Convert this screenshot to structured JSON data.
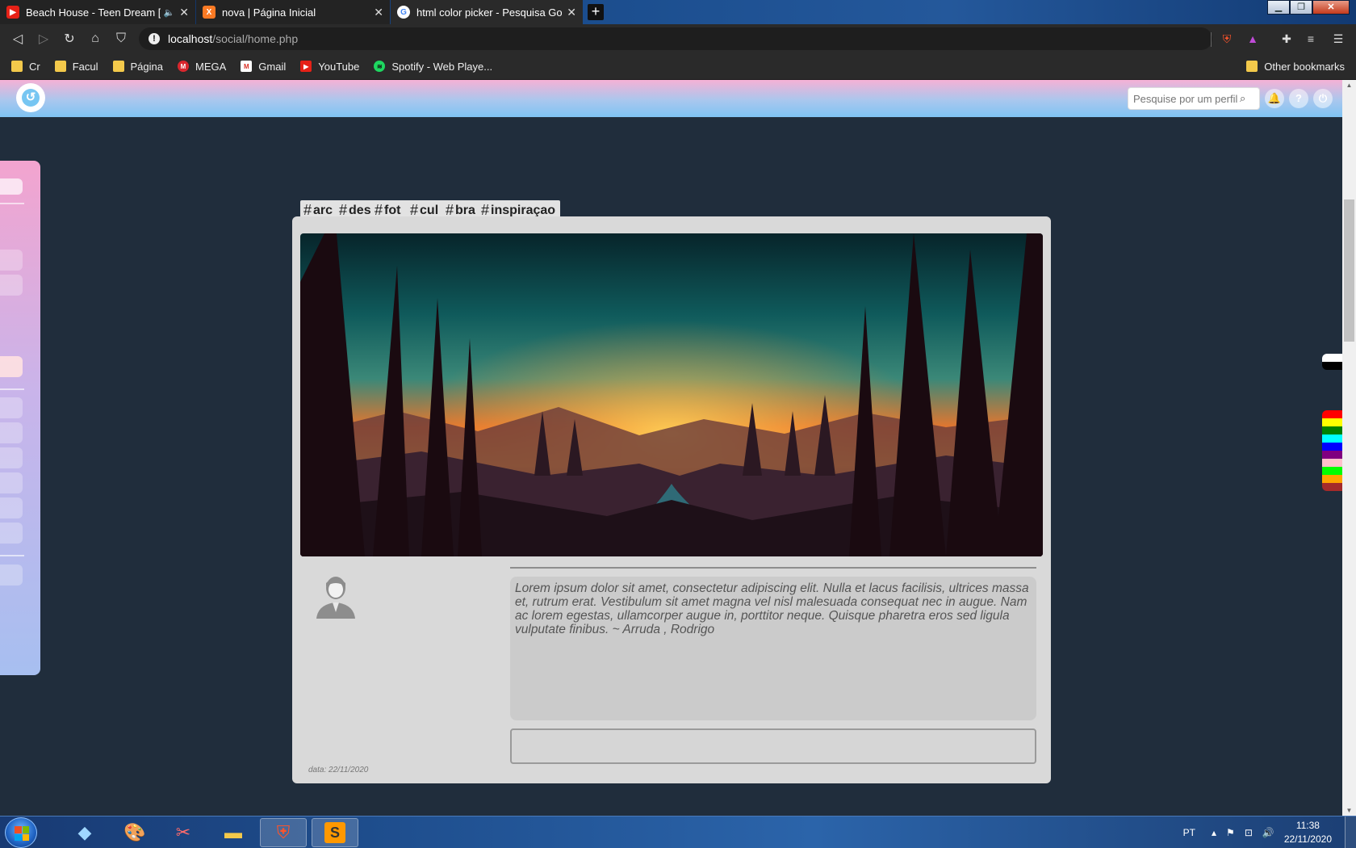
{
  "browser": {
    "tabs": [
      {
        "title": "Beach House - Teen Dream [F",
        "favicon": "youtube-icon",
        "active": false,
        "audio": true
      },
      {
        "title": "nova | Página Inicial",
        "favicon": "xampp-icon",
        "active": false
      },
      {
        "title": "html color picker - Pesquisa Googl",
        "favicon": "google-icon",
        "active": true
      }
    ],
    "url_host": "localhost",
    "url_path": "/social/home.php",
    "bookmarks": [
      {
        "label": "Cr",
        "icon": "folder-icon"
      },
      {
        "label": "Facul",
        "icon": "folder-icon"
      },
      {
        "label": "Página",
        "icon": "folder-icon"
      },
      {
        "label": "MEGA",
        "icon": "mega-icon"
      },
      {
        "label": "Gmail",
        "icon": "gmail-icon"
      },
      {
        "label": "YouTube",
        "icon": "youtube-icon"
      },
      {
        "label": "Spotify - Web Playe...",
        "icon": "spotify-icon"
      }
    ],
    "other_bookmarks": "Other bookmarks"
  },
  "site": {
    "search_placeholder": "Pesquise por um perfil",
    "tags": [
      "arc",
      "des",
      "fot",
      "cul",
      "bra",
      "inspiraçao"
    ],
    "post": {
      "text": "Lorem ipsum dolor sit amet, consectetur adipiscing elit. Nulla et lacus facilisis, ultrices massa et, rutrum erat. Vestibulum sit amet magna vel nisl malesuada consequat nec in augue. Nam ac lorem egestas, ullamcorper augue in, porttitor neque. Quisque pharetra eros sed ligula vulputate finibus. ~ Arruda , Rodrigo",
      "date": "data: 22/11/2020"
    },
    "color_swatches_top": [
      "#ffffff",
      "#000000"
    ],
    "color_swatches": [
      "#ff0000",
      "#ffff00",
      "#008000",
      "#00ffff",
      "#0000ff",
      "#800080",
      "#ffc0cb",
      "#00ff00",
      "#ffa500",
      "#a52a2a"
    ]
  },
  "taskbar": {
    "language": "PT",
    "time": "11:38",
    "date": "22/11/2020"
  }
}
